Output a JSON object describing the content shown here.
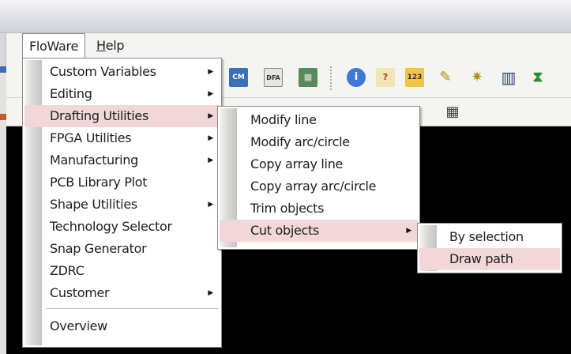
{
  "menubar": {
    "items": [
      {
        "label": "FloWare",
        "open": true
      },
      {
        "label": "Help",
        "mnemonic": "H",
        "rest": "elp"
      }
    ]
  },
  "main_menu": {
    "items": [
      {
        "label": "Custom Variables",
        "submenu": true
      },
      {
        "label": "Editing",
        "submenu": true
      },
      {
        "label": "Drafting Utilities",
        "submenu": true,
        "highlighted": true
      },
      {
        "label": "FPGA Utilities",
        "submenu": true
      },
      {
        "label": "Manufacturing",
        "submenu": true
      },
      {
        "label": "PCB Library Plot",
        "submenu": false
      },
      {
        "label": "Shape Utilities",
        "submenu": true
      },
      {
        "label": "Technology Selector",
        "submenu": false
      },
      {
        "label": "Snap Generator",
        "submenu": false
      },
      {
        "label": "ZDRC",
        "submenu": false
      },
      {
        "label": "Customer",
        "submenu": true
      },
      {
        "label": "Overview",
        "submenu": false
      }
    ]
  },
  "drafting_submenu": {
    "items": [
      {
        "label": "Modify line",
        "submenu": false
      },
      {
        "label": "Modify arc/circle",
        "submenu": false
      },
      {
        "label": "Copy array line",
        "submenu": false
      },
      {
        "label": "Copy array arc/circle",
        "submenu": false
      },
      {
        "label": "Trim objects",
        "submenu": false
      },
      {
        "label": "Cut objects",
        "submenu": true,
        "highlighted": true
      }
    ]
  },
  "cut_submenu": {
    "items": [
      {
        "label": "By selection",
        "highlighted": false
      },
      {
        "label": "Draw path",
        "highlighted": true
      }
    ]
  },
  "toolbar": {
    "icons": [
      {
        "name": "cm-icon",
        "glyph": "CM"
      },
      {
        "name": "dfa-icon",
        "glyph": "DFA"
      },
      {
        "name": "board-icon",
        "glyph": "▦"
      },
      {
        "name": "info-icon",
        "glyph": "i"
      },
      {
        "name": "report-icon",
        "glyph": "?"
      },
      {
        "name": "measure-icon",
        "glyph": "123"
      },
      {
        "name": "brush-icon",
        "glyph": "✎"
      },
      {
        "name": "highlight-icon",
        "glyph": "✷"
      },
      {
        "name": "bars-icon",
        "glyph": "▥"
      },
      {
        "name": "hourglass-icon",
        "glyph": "⧗"
      }
    ],
    "row2_icon": {
      "name": "grid-icon",
      "glyph": "▦"
    }
  },
  "colors": {
    "highlight": "#f1d7d7",
    "canvas": "#000000",
    "menu_border": "#8a8a8a"
  }
}
